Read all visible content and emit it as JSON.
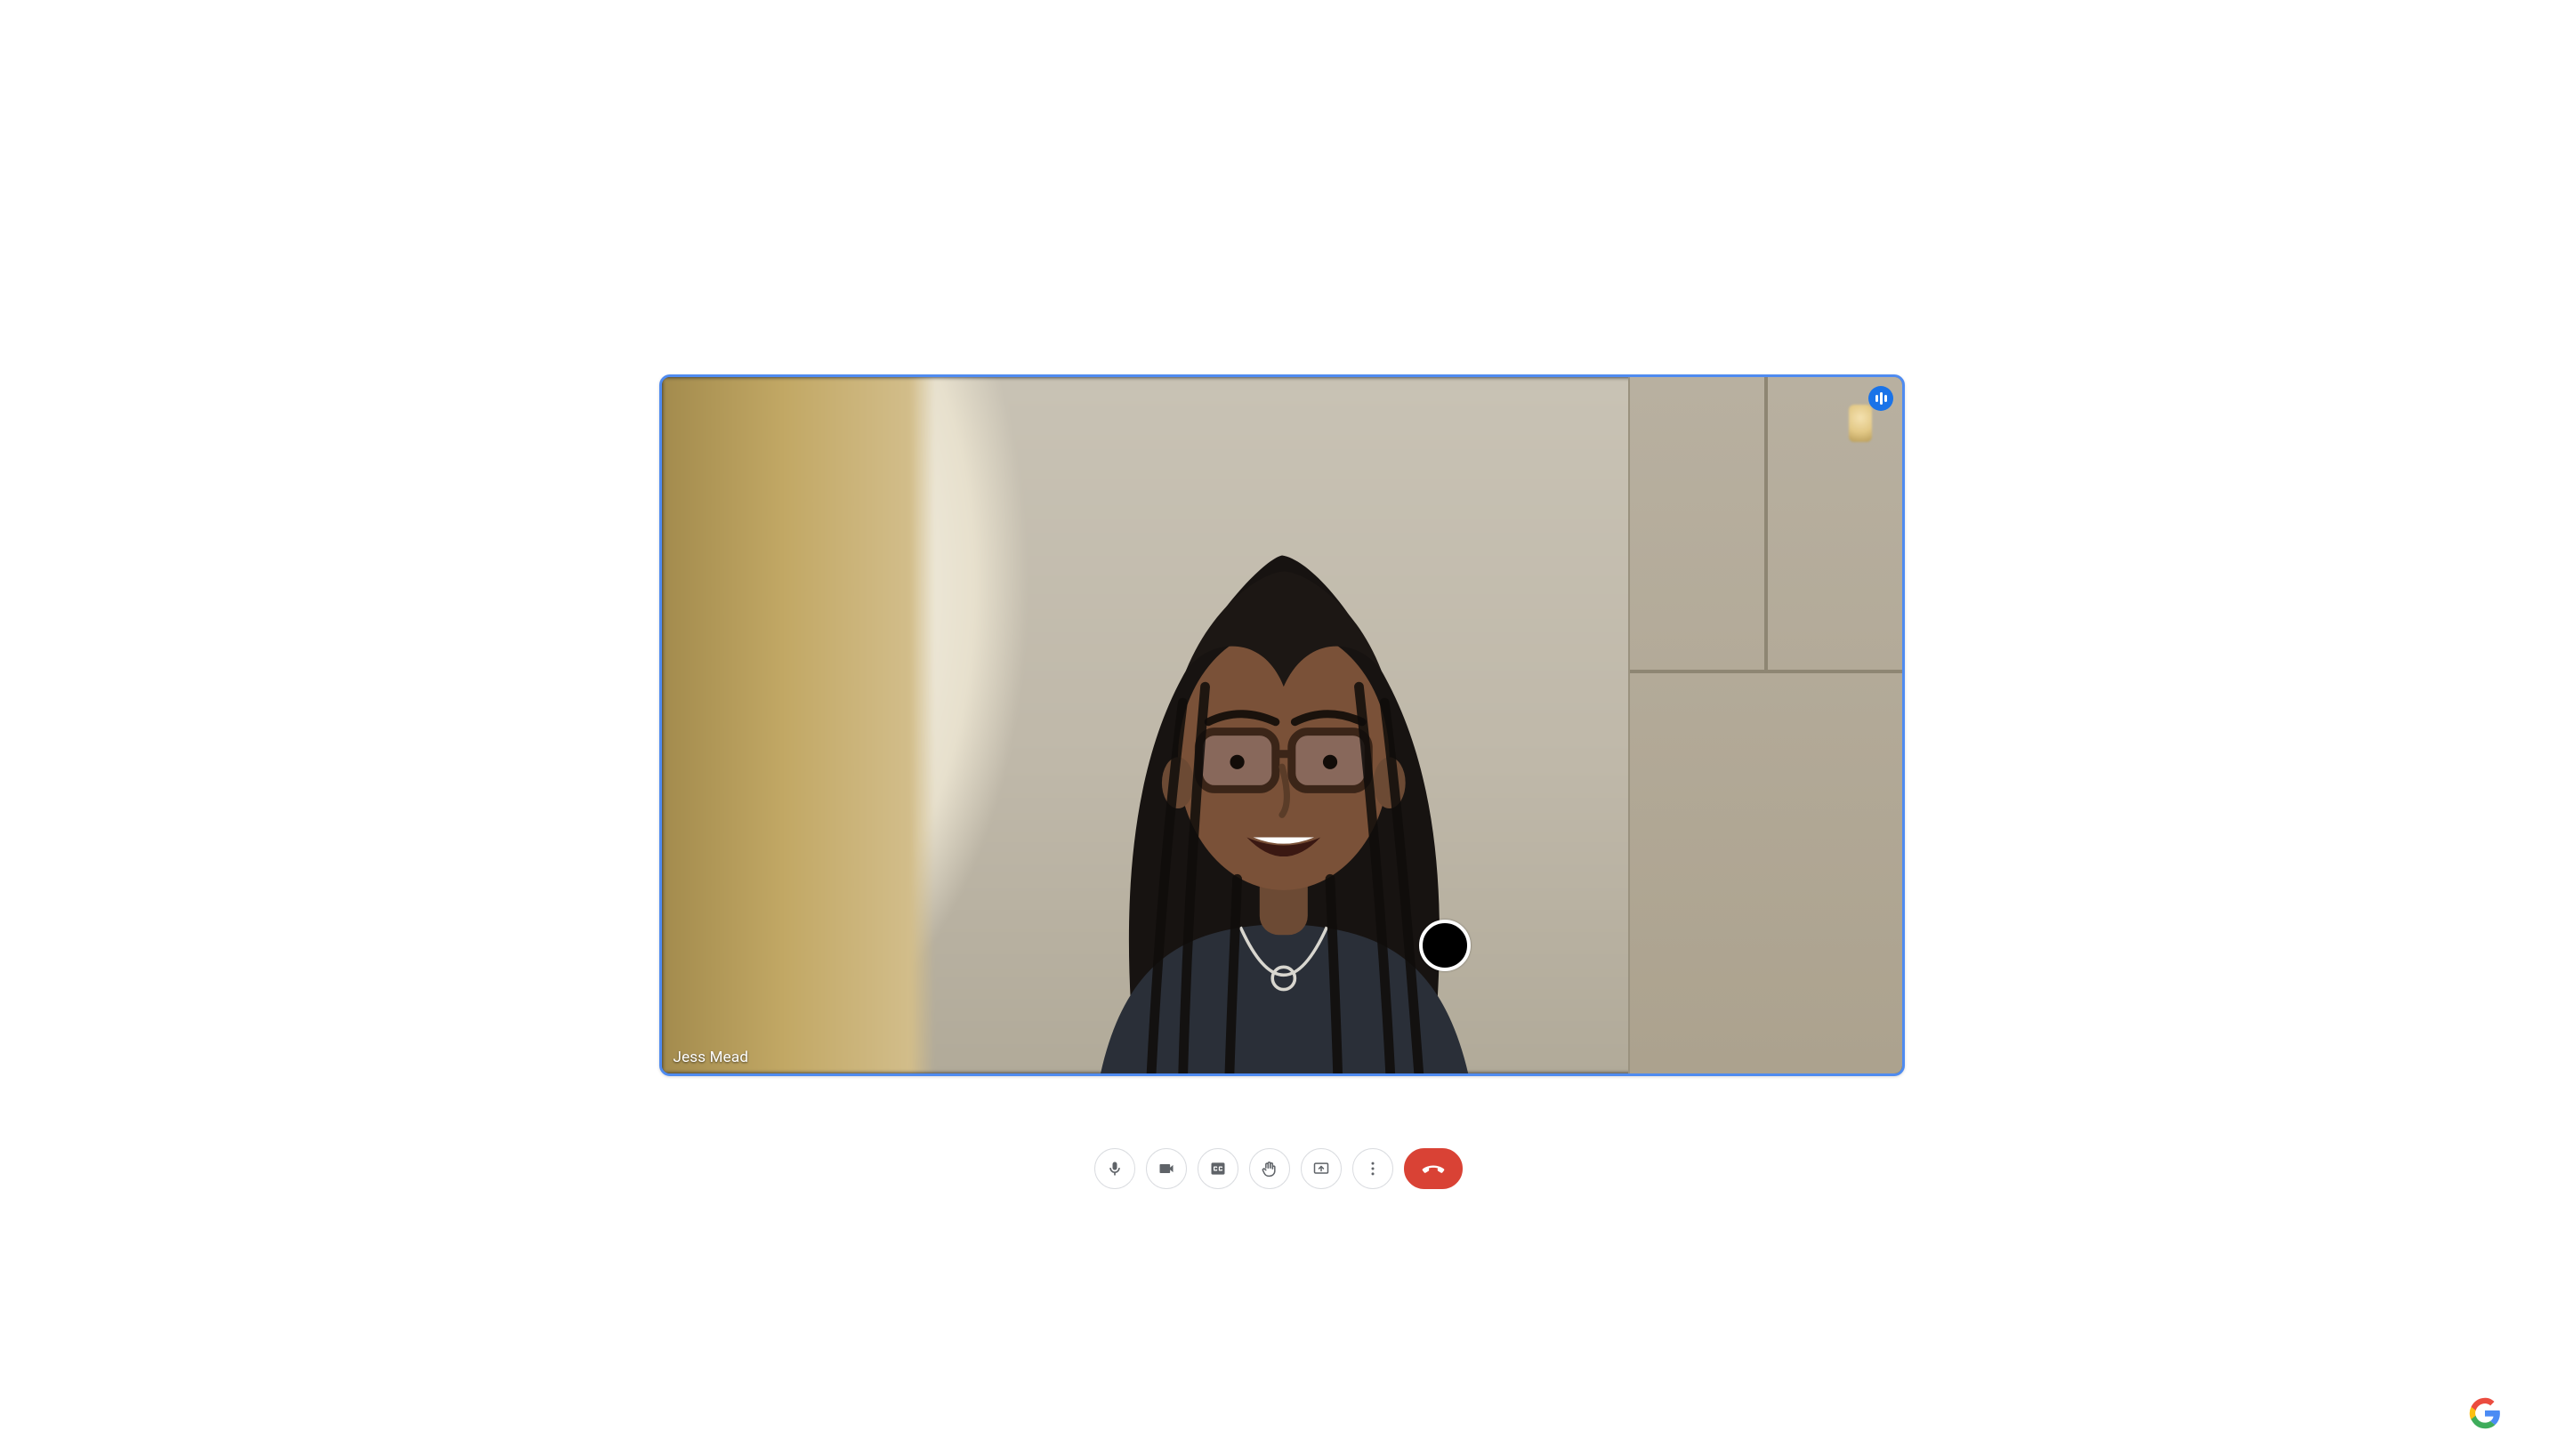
{
  "participant": {
    "name": "Jess Mead",
    "is_speaking": true
  },
  "colors": {
    "active_border": "#4f8bf0",
    "speaking_badge": "#1a73e8",
    "end_call_bg": "#d94235",
    "icon_gray": "#5f6368",
    "button_border": "#dadce0"
  },
  "toolbar": {
    "mic": {
      "name": "microphone-button",
      "aria": "Toggle microphone"
    },
    "camera": {
      "name": "camera-button",
      "aria": "Toggle camera"
    },
    "captions": {
      "name": "captions-button",
      "aria": "Toggle captions"
    },
    "raise_hand": {
      "name": "raise-hand-button",
      "aria": "Raise hand"
    },
    "present": {
      "name": "present-screen-button",
      "aria": "Present screen"
    },
    "more": {
      "name": "more-options-button",
      "aria": "More options"
    },
    "end": {
      "name": "end-call-button",
      "aria": "Leave call"
    }
  }
}
